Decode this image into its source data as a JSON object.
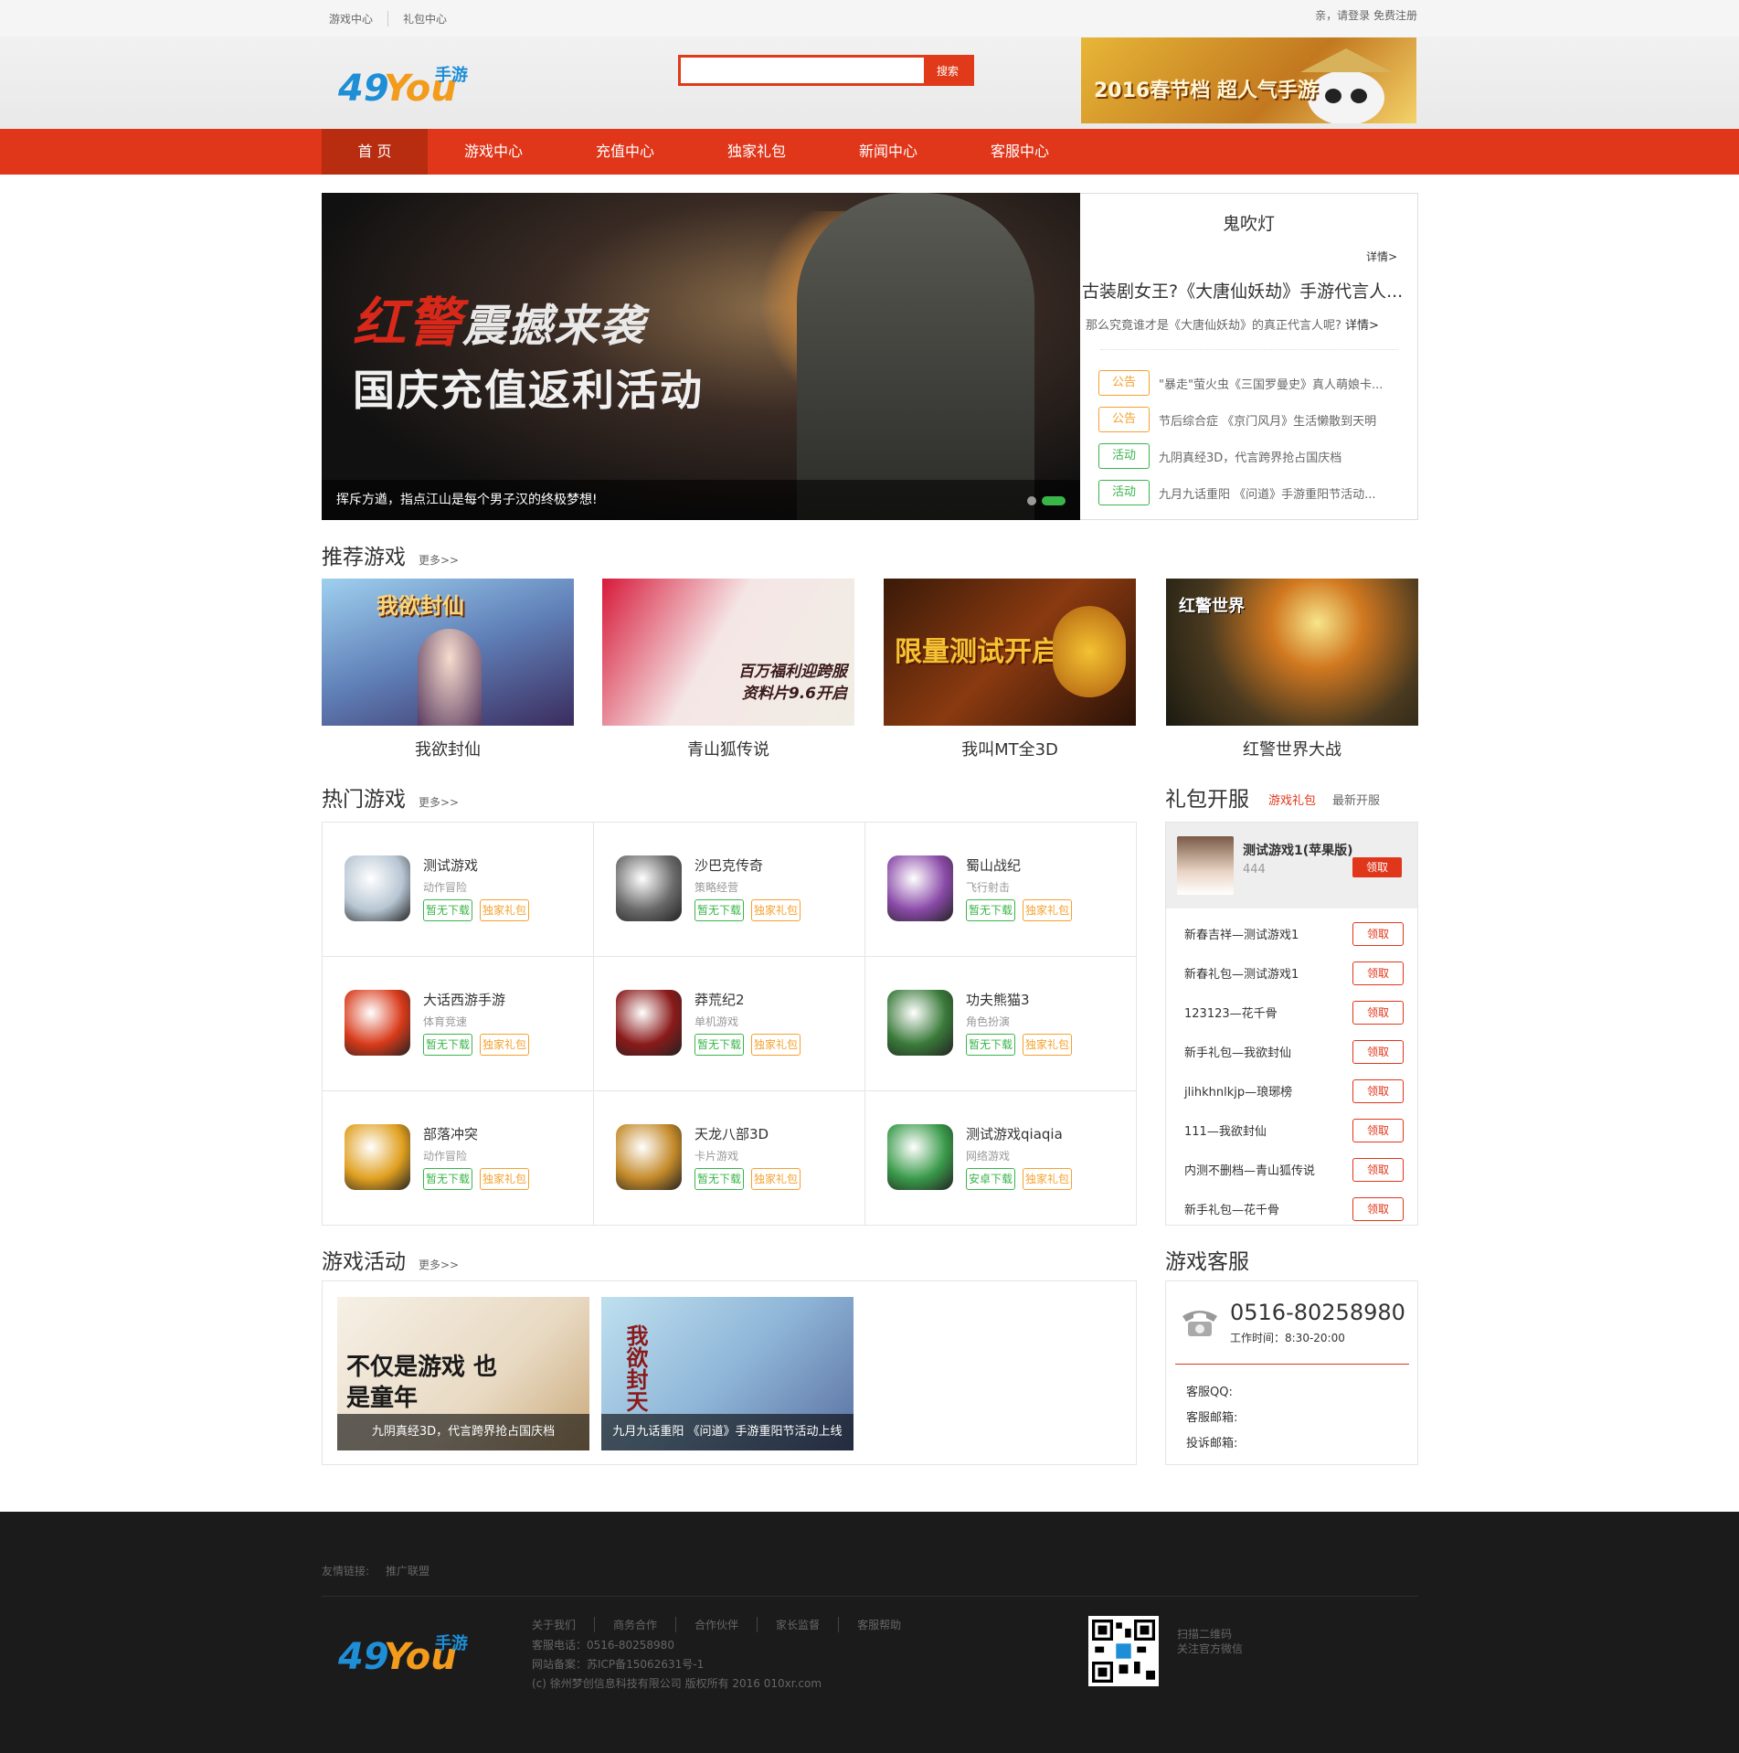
{
  "topbar": {
    "links": [
      "游戏中心",
      "礼包中心"
    ],
    "right_text": "亲，请登录 免费注册"
  },
  "header": {
    "search_button": "搜索",
    "search_placeholder": "",
    "ad_text": "2016春节档 超人气手游"
  },
  "nav": {
    "items": [
      "首 页",
      "游戏中心",
      "充值中心",
      "独家礼包",
      "新闻中心",
      "客服中心"
    ],
    "active": "首 页"
  },
  "hero": {
    "title_line1": "红警",
    "title_line1b": "震撼来袭",
    "title_line2": "国庆充值返利活动",
    "caption": "挥斥方遒，指点江山是每个男子汉的终极梦想!"
  },
  "news": {
    "headline": "鬼吹灯",
    "more": "详情>",
    "headline2": "古装剧女王?《大唐仙妖劫》手游代言人...",
    "desc": "那么究竟谁才是《大唐仙妖劫》的真正代言人呢?",
    "desc_more": "详情>",
    "items": [
      {
        "tag": "公告",
        "type": "notice",
        "text": "\"暴走\"萤火虫《三国罗曼史》真人萌娘卡..."
      },
      {
        "tag": "公告",
        "type": "notice",
        "text": "节后综合症 《京门风月》生活懒散到天明"
      },
      {
        "tag": "活动",
        "type": "act",
        "text": "九阴真经3D，代言跨界抢占国庆档"
      },
      {
        "tag": "活动",
        "type": "act",
        "text": "九月九话重阳 《问道》手游重阳节活动..."
      }
    ]
  },
  "recommend": {
    "title": "推荐游戏",
    "more": "更多>>",
    "games": [
      {
        "name": "我欲封仙",
        "img_text": "我欲封仙"
      },
      {
        "name": "青山狐传说",
        "img_text": "百万福利迎跨服 资料片9.6开启"
      },
      {
        "name": "我叫MT全3D",
        "img_text": "限量测试开启"
      },
      {
        "name": "红警世界大战",
        "img_text": "红警世界"
      }
    ]
  },
  "hot": {
    "title": "热门游戏",
    "more": "更多>>",
    "games": [
      {
        "name": "测试游戏",
        "cat": "动作冒险",
        "dl": "暂无下载",
        "gift": "独家礼包",
        "color": "#b7c6d3"
      },
      {
        "name": "沙巴克传奇",
        "cat": "策略经营",
        "dl": "暂无下载",
        "gift": "独家礼包",
        "color": "#6a6a6a"
      },
      {
        "name": "蜀山战纪",
        "cat": "飞行射击",
        "dl": "暂无下载",
        "gift": "独家礼包",
        "color": "#8a4aa8"
      },
      {
        "name": "大话西游手游",
        "cat": "体育竞速",
        "dl": "暂无下载",
        "gift": "独家礼包",
        "color": "#d83a1a"
      },
      {
        "name": "莽荒纪2",
        "cat": "单机游戏",
        "dl": "暂无下载",
        "gift": "独家礼包",
        "color": "#8a1a1a"
      },
      {
        "name": "功夫熊猫3",
        "cat": "角色扮演",
        "dl": "暂无下载",
        "gift": "独家礼包",
        "color": "#3a7a3a"
      },
      {
        "name": "部落冲突",
        "cat": "动作冒险",
        "dl": "暂无下载",
        "gift": "独家礼包",
        "color": "#e0a020"
      },
      {
        "name": "天龙八部3D",
        "cat": "卡片游戏",
        "dl": "暂无下载",
        "gift": "独家礼包",
        "color": "#c48a2a"
      },
      {
        "name": "测试游戏qiaqia",
        "cat": "网络游戏",
        "dl": "安卓下载",
        "gift": "独家礼包",
        "color": "#3a9a4a"
      }
    ]
  },
  "gift": {
    "title": "礼包开服",
    "tab1": "游戏礼包",
    "tab2": "最新开服",
    "top": {
      "name": "测试游戏1(苹果版)",
      "count": "444",
      "btn": "领取"
    },
    "items": [
      {
        "name": "新春吉祥—测试游戏1",
        "btn": "领取"
      },
      {
        "name": "新春礼包—测试游戏1",
        "btn": "领取"
      },
      {
        "name": "123123—花千骨",
        "btn": "领取"
      },
      {
        "name": "新手礼包—我欲封仙",
        "btn": "领取"
      },
      {
        "name": "jlihkhnlkjp—琅琊榜",
        "btn": "领取"
      },
      {
        "name": "111—我欲封仙",
        "btn": "领取"
      },
      {
        "name": "内测不删档—青山狐传说",
        "btn": "领取"
      },
      {
        "name": "新手礼包—花千骨",
        "btn": "领取"
      }
    ]
  },
  "activity": {
    "title": "游戏活动",
    "more": "更多>>",
    "items": [
      {
        "caption": "九阴真经3D，代言跨界抢占国庆档",
        "img_text": "不仅是游戏 也是童年"
      },
      {
        "caption": "九月九话重阳 《问道》手游重阳节活动上线",
        "img_text": "我欲封天"
      }
    ]
  },
  "service": {
    "title": "游戏客服",
    "phone": "0516-80258980",
    "hours": "工作时间：8:30-20:00",
    "qq": "客服QQ:",
    "email": "客服邮箱:",
    "complaint": "投诉邮箱:"
  },
  "footer": {
    "friend_label": "友情链接:",
    "friend_link": "推广联盟",
    "nav": [
      "关于我们",
      "商务合作",
      "合作伙伴",
      "家长监督",
      "客服帮助"
    ],
    "tel": "客服电话：0516-80258980",
    "icp": "网站备案：苏ICP备15062631号-1",
    "copyright": "(c) 徐州梦创信息科技有限公司 版权所有 2016 010xr.com",
    "qr_line1": "扫描二维码",
    "qr_line2": "关注官方微信"
  },
  "colors": {
    "brand": "#e0361a",
    "green": "#39b54a",
    "orange": "#f4a12e"
  }
}
